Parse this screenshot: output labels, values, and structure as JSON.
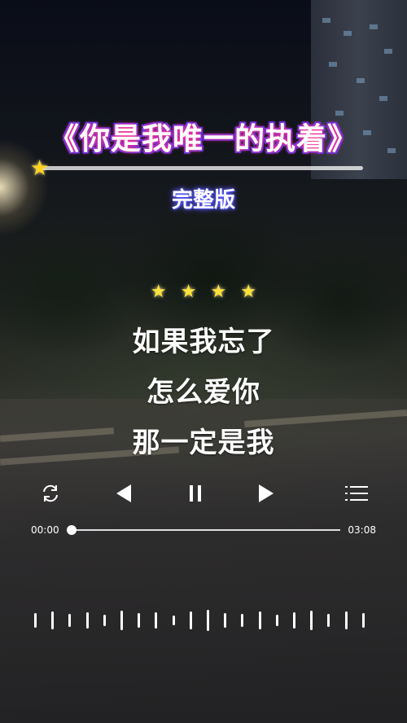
{
  "song": {
    "title": "《你是我唯一的执着》",
    "version": "完整版",
    "rating_stars": 4
  },
  "lyrics": [
    "如果我忘了",
    "怎么爱你",
    "那一定是我"
  ],
  "player": {
    "current_time": "00:00",
    "total_time": "03:08",
    "progress": 0.0
  },
  "icons": {
    "repeat": "repeat-icon",
    "previous": "previous-icon",
    "pause": "pause-icon",
    "next": "next-icon",
    "playlist": "playlist-icon"
  },
  "colors": {
    "title_glow": "#ff2d8c",
    "title_outline": "#3a3cff",
    "star": "#ffd21f"
  }
}
